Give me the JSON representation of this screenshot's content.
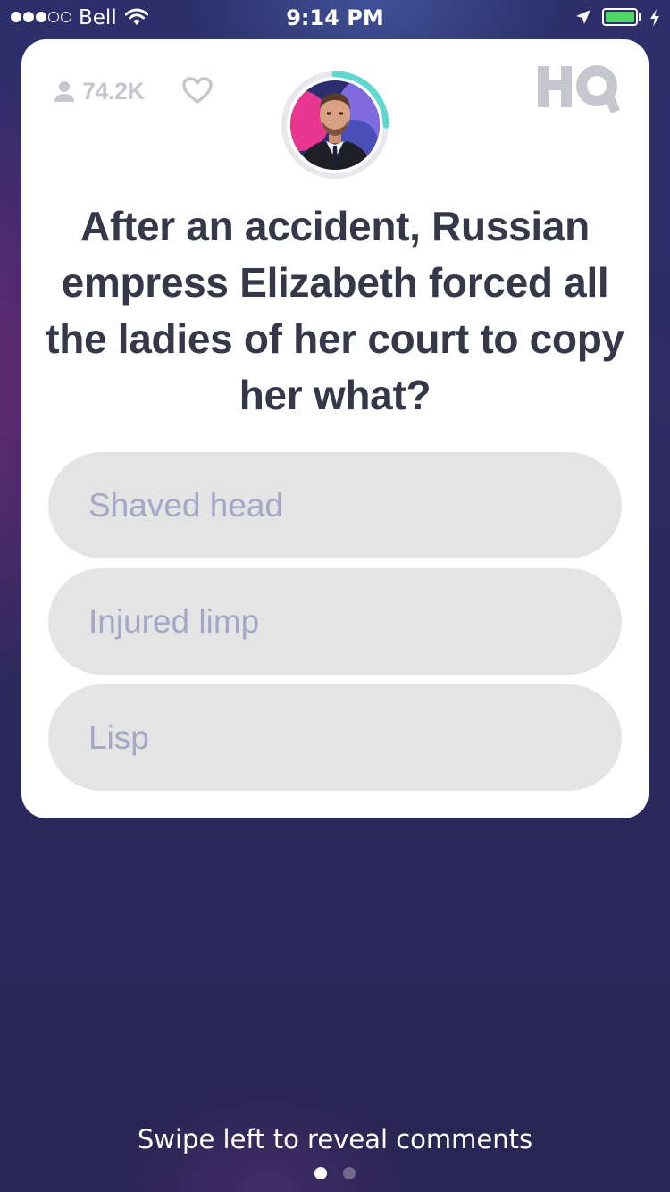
{
  "status_bar": {
    "carrier": "Bell",
    "time": "9:14 PM",
    "signal_bars_filled": 3,
    "signal_bars_total": 5,
    "battery_level": 1.0,
    "battery_color": "#4cd964",
    "icons": [
      "wifi-icon",
      "location-arrow-icon",
      "battery-icon",
      "charging-bolt-icon"
    ]
  },
  "card": {
    "viewer_count": "74.2K",
    "icons": [
      "person-icon",
      "heart-icon",
      "hq-logo",
      "host-avatar"
    ],
    "timer_ring_color": "#5fd8d0",
    "question": "After an accident, Russian empress Elizabeth forced all the ladies of her court to copy her what?",
    "answers": [
      {
        "label": "Shaved head"
      },
      {
        "label": "Injured limp"
      },
      {
        "label": "Lisp"
      }
    ]
  },
  "footer": {
    "hint": "Swipe left to reveal comments",
    "page_count": 2,
    "active_page": 1
  },
  "colors": {
    "background": "#2d2b62",
    "card": "#ffffff",
    "question_text": "#363849",
    "answer_bg": "#e4e4e4",
    "answer_text": "#a6a6c6",
    "muted_icon": "#c6c6cf"
  }
}
